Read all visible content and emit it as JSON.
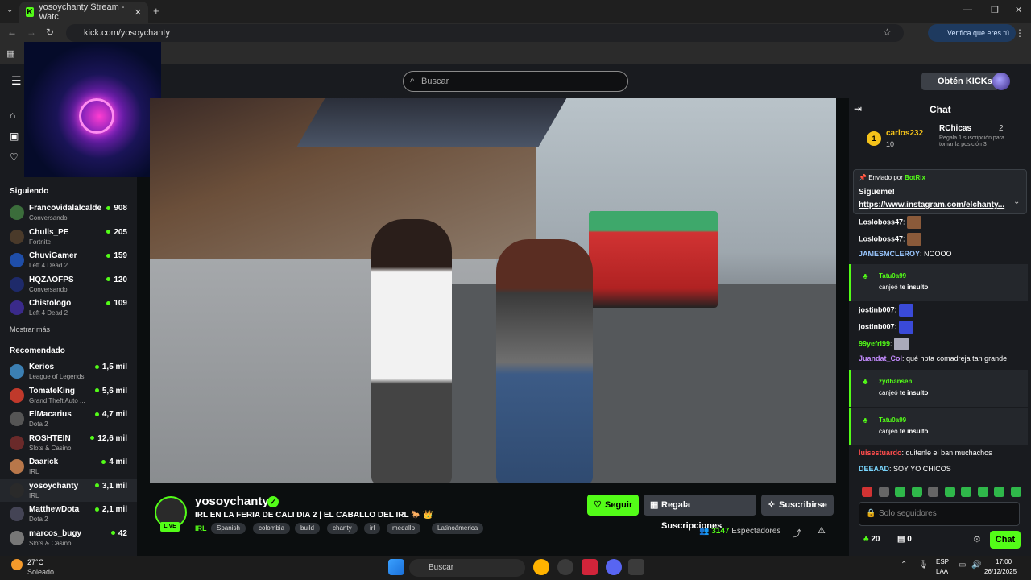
{
  "browser": {
    "tab_title": "yosoychanty Stream - Watc",
    "url": "kick.com/yosoychanty",
    "verify_label": "Verifica que eres tú"
  },
  "header": {
    "search_placeholder": "Buscar",
    "get_kicks": "Obtén KICKs"
  },
  "sidebar": {
    "following_title": "Siguiendo",
    "following": [
      {
        "name": "Francovidalalcalde",
        "game": "Conversando",
        "viewers": "908"
      },
      {
        "name": "Chulls_PE",
        "game": "Fortnite",
        "viewers": "205"
      },
      {
        "name": "ChuviGamer",
        "game": "Left 4 Dead 2",
        "viewers": "159"
      },
      {
        "name": "HQZAOFPS",
        "game": "Conversando",
        "viewers": "120"
      },
      {
        "name": "Chistologo",
        "game": "Left 4 Dead 2",
        "viewers": "109"
      }
    ],
    "show_more": "Mostrar más",
    "recommended_title": "Recomendado",
    "recommended": [
      {
        "name": "Kerios",
        "game": "League of Legends",
        "viewers": "1,5 mil"
      },
      {
        "name": "TomateKing",
        "game": "Grand Theft Auto ...",
        "viewers": "5,6 mil"
      },
      {
        "name": "ElMacarius",
        "game": "Dota 2",
        "viewers": "4,7 mil"
      },
      {
        "name": "ROSHTEIN",
        "game": "Slots & Casino",
        "viewers": "12,6 mil"
      },
      {
        "name": "Daarick",
        "game": "IRL",
        "viewers": "4 mil"
      },
      {
        "name": "yosoychanty",
        "game": "IRL",
        "viewers": "3,1 mil"
      },
      {
        "name": "MatthewDota",
        "game": "Dota 2",
        "viewers": "2,1 mil"
      },
      {
        "name": "marcos_bugy",
        "game": "Slots & Casino",
        "viewers": "42"
      }
    ]
  },
  "stream": {
    "channel": "yosoychanty",
    "live": "LIVE",
    "title": "IRL EN LA FERIA DE CALI DIA 2 | EL CABALLO DEL IRL 🐎 👑",
    "category": "IRL",
    "tags": [
      "Spanish",
      "colombia",
      "build",
      "chanty",
      "irl",
      "medallo",
      "Latinoámerica"
    ],
    "follow": "Seguir",
    "gift_subs": "Regala Suscripciones",
    "subscribe": "Suscribirse",
    "viewers_count": "3147",
    "viewers_label": "Espectadores"
  },
  "chat": {
    "title": "Chat",
    "leader1": {
      "name": "carlos232",
      "count": "10"
    },
    "leader2": {
      "name": "RChicas",
      "count": "2",
      "note": "Regala 1 suscripción para tomar la posición 3"
    },
    "pinned_by": "Enviado por",
    "pinned_user": "BotRix",
    "pinned_line1": "Sigueme!",
    "pinned_line2": "https://www.instagram.com/elchanty...",
    "messages": [
      {
        "user": "Losloboss47",
        "text": ""
      },
      {
        "user": "Losloboss47",
        "text": ""
      },
      {
        "user": "JAMESMCLEROY",
        "text": "NOOOO"
      },
      {
        "user": "jostinb007",
        "text": ""
      },
      {
        "user": "jostinb007",
        "text": ""
      },
      {
        "user": "99yefri99",
        "text": ""
      },
      {
        "user": "Juandat_Col",
        "text": "qué hpta comadreja tan grande"
      },
      {
        "user": "luisestuardo",
        "text": "quitenle el ban muchachos"
      },
      {
        "user": "DEEAAD",
        "text": "SOY YO CHICOS"
      }
    ],
    "redeems": [
      {
        "user": "Tatu0a99",
        "pre": "canjeó",
        "item": "te insulto"
      },
      {
        "user": "zydhansen",
        "pre": "canjeó",
        "item": "te insulto"
      },
      {
        "user": "Tatu0a99",
        "pre": "canjeó",
        "item": "te insulto"
      }
    ],
    "input_placeholder": "Solo seguidores",
    "points": "20",
    "boxes": "0",
    "send": "Chat"
  },
  "taskbar": {
    "temp": "27°C",
    "weather": "Soleado",
    "search": "Buscar",
    "lang1": "ESP",
    "lang2": "LAA",
    "time": "17:00",
    "date": "26/12/2025"
  },
  "colors": {
    "accent": "#53fc18",
    "bg": "#0b0e0f",
    "panel": "#191b1f"
  }
}
